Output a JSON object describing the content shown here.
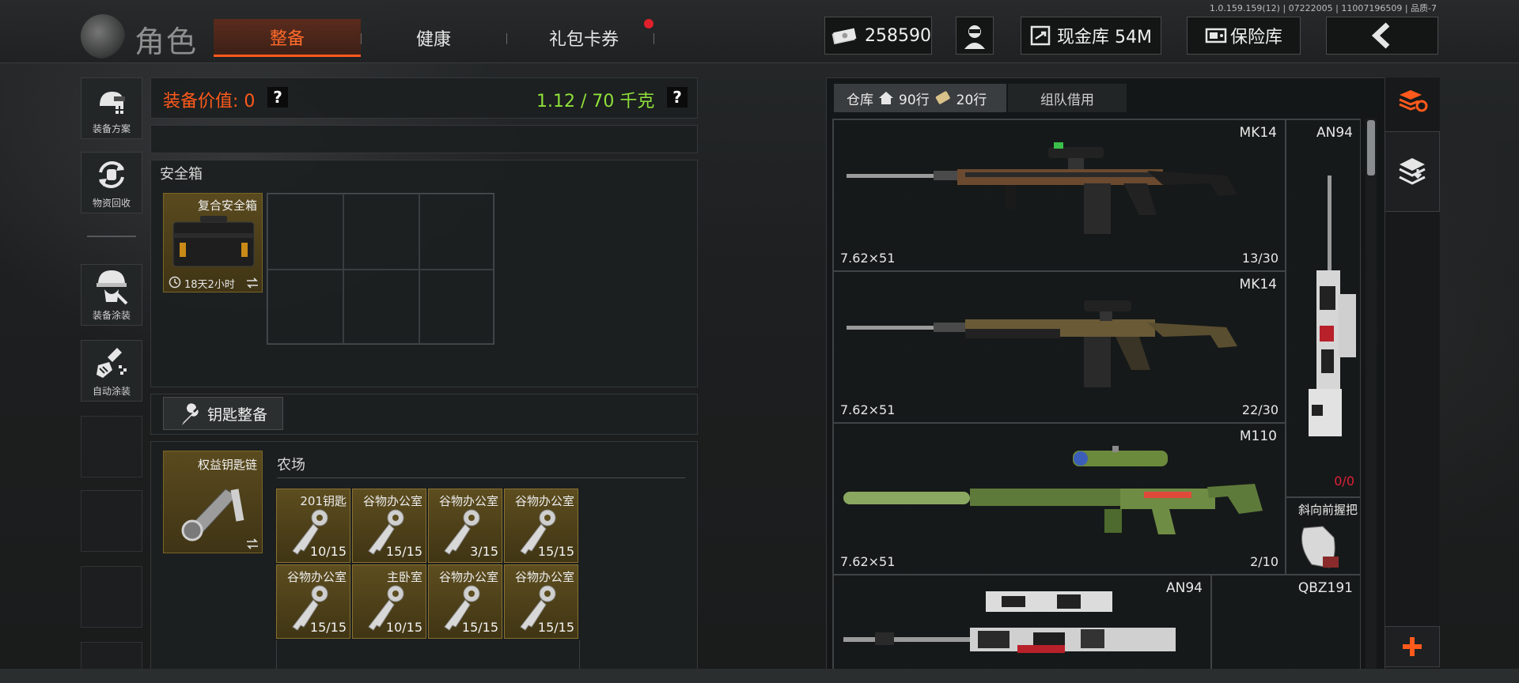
{
  "version": "1.0.159.159(12) | 07222005 | 11007196509 | 品质-7",
  "header": {
    "title": "角色",
    "tabs": [
      {
        "label": "整备",
        "active": true
      },
      {
        "label": "健康",
        "active": false
      },
      {
        "label": "礼包卡券",
        "active": false,
        "badge": true
      }
    ],
    "currency": "258590",
    "cash_vault": "现金库 54M",
    "safe_vault": "保险库"
  },
  "left_nav": [
    {
      "label": "装备方案",
      "icon": "helmet-plan-icon"
    },
    {
      "label": "物资回收",
      "icon": "recycle-icon"
    },
    {
      "label": "装备涂装",
      "icon": "helmet-paint-icon"
    },
    {
      "label": "自动涂装",
      "icon": "spray-brush-icon"
    }
  ],
  "equipment": {
    "value_label": "装备价值: 0",
    "weight": "1.12 / 70 千克",
    "help": "?"
  },
  "safebox": {
    "title": "安全箱",
    "item_name": "复合安全箱",
    "timer": "18天2小时"
  },
  "keys": {
    "button_label": "钥匙整备",
    "keychain_name": "权益钥匙链",
    "location": "农场",
    "items": [
      {
        "name": "201钥匙",
        "count": "10/15"
      },
      {
        "name": "谷物办公室",
        "count": "15/15"
      },
      {
        "name": "谷物办公室",
        "count": "3/15"
      },
      {
        "name": "谷物办公室",
        "count": "15/15"
      },
      {
        "name": "谷物办公室",
        "count": "15/15"
      },
      {
        "name": "主卧室",
        "count": "10/15"
      },
      {
        "name": "谷物办公室",
        "count": "15/15"
      },
      {
        "name": "谷物办公室",
        "count": "15/15"
      }
    ]
  },
  "warehouse": {
    "tab_label": "仓库",
    "rows_home": "90行",
    "rows_cash": "20行",
    "team_borrow": "组队借用",
    "weapons": [
      {
        "name": "MK14",
        "caliber": "7.62×51",
        "ammo": "13/30"
      },
      {
        "name": "MK14",
        "caliber": "7.62×51",
        "ammo": "22/30"
      },
      {
        "name": "M110",
        "caliber": "7.62×51",
        "ammo": "2/10"
      },
      {
        "name": "AN94",
        "caliber": "",
        "ammo": ""
      }
    ],
    "side_weapon": {
      "name": "AN94",
      "ammo": "0/0"
    },
    "grip": {
      "name": "斜向前握把"
    },
    "bottom_right_weapon": {
      "name": "QBZ191"
    }
  },
  "colors": {
    "accent": "#ff5a1c",
    "weight_green": "#8fe03a",
    "gold_cell": "#5d4d1f",
    "ammo_red": "#e0203a"
  }
}
